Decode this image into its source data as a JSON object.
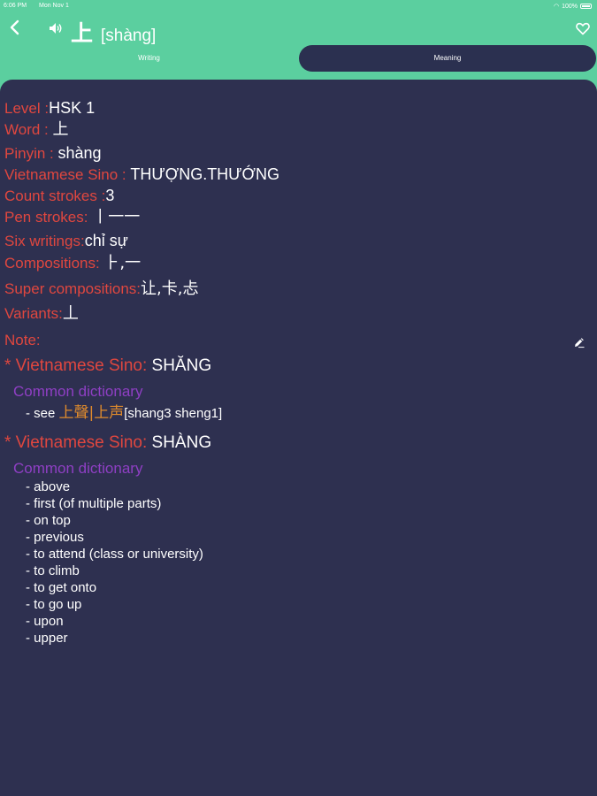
{
  "status_bar": {
    "time": "6:06 PM",
    "date": "Mon Nov 1",
    "battery": "100%"
  },
  "header": {
    "title_char": "上",
    "title_pinyin": "[shàng]"
  },
  "tabs": [
    {
      "label": "Writing",
      "active": false
    },
    {
      "label": "Meaning",
      "active": true
    }
  ],
  "details": [
    {
      "label": "Level :",
      "value": "HSK 1"
    },
    {
      "label": "Word : ",
      "value": "上"
    },
    {
      "label": "Pinyin : ",
      "value": "shàng"
    },
    {
      "label": "Vietnamese Sino : ",
      "value": "THƯỢNG.THƯỚNG"
    },
    {
      "label": "Count strokes :",
      "value": "3"
    },
    {
      "label": "Pen strokes: ",
      "value": "丨一一"
    },
    {
      "label": "Six writings:",
      "value": "chỉ sự"
    },
    {
      "label": "Compositions: ",
      "value": "⺊,一"
    },
    {
      "label": "Super compositions:",
      "value": "让,卡,忐"
    },
    {
      "label": "Variants:",
      "value": "丄"
    }
  ],
  "note": {
    "label": "Note:"
  },
  "entries": [
    {
      "heading_label": "* Vietnamese Sino: ",
      "heading_value": "SHĂNG",
      "dictionary": "Common dictionary",
      "definitions": [
        {
          "prefix": "- see ",
          "link": "上聲|上声",
          "suffix": "[shang3 sheng1]"
        }
      ]
    },
    {
      "heading_label": "* Vietnamese Sino: ",
      "heading_value": "SHÀNG",
      "dictionary": "Common dictionary",
      "definitions": [
        {
          "text": "- above"
        },
        {
          "text": "- first (of multiple parts)"
        },
        {
          "text": "- on top"
        },
        {
          "text": "- previous"
        },
        {
          "text": "- to attend (class or university)"
        },
        {
          "text": "- to climb"
        },
        {
          "text": "- to get onto"
        },
        {
          "text": "- to go up"
        },
        {
          "text": "- upon"
        },
        {
          "text": "- upper"
        }
      ]
    }
  ],
  "colors": {
    "accent_green": "#5bcf9f",
    "panel_navy": "#2e3050",
    "label_red": "#e0473f",
    "dict_purple": "#8f3fc4",
    "link_orange": "#e08b2c"
  },
  "icons": [
    "back-chevron-icon",
    "speaker-icon",
    "heart-icon",
    "edit-pencil-icon",
    "wifi-icon",
    "battery-icon"
  ]
}
